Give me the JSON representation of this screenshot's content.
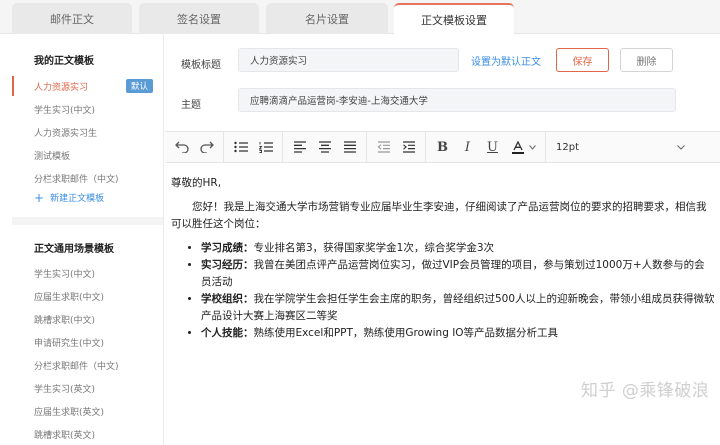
{
  "tabs": [
    "邮件正文",
    "签名设置",
    "名片设置",
    "正文模板设置"
  ],
  "sidebar": {
    "my_title": "我的正文模板",
    "my_items": [
      {
        "label": "人力资源实习",
        "badge": "默认"
      },
      {
        "label": "学生实习(中文)"
      },
      {
        "label": "人力资源实习生"
      },
      {
        "label": "测试模板"
      },
      {
        "label": "分栏求职邮件（中文)"
      }
    ],
    "new_label": "新建正文模板",
    "common_title": "正文通用场景模板",
    "common_items": [
      "学生实习(中文)",
      "应届生求职(中文)",
      "跳槽求职(中文)",
      "申请研究生(中文)",
      "分栏求职邮件（中文)",
      "学生实习(英文)",
      "应届生求职(英文)",
      "跳槽求职(英文)"
    ]
  },
  "form": {
    "title_label": "模板标题",
    "title_value": "人力资源实习",
    "subject_label": "主题",
    "subject_value": "应聘滴滴产品运营岗-李安迪-上海交通大学",
    "set_default": "设置为默认正文",
    "save": "保存",
    "delete": "删除"
  },
  "toolbar": {
    "icons": [
      "undo-icon",
      "redo-icon",
      "bullet-list-icon",
      "numbered-list-icon",
      "align-left-icon",
      "align-center-icon",
      "align-justify-icon",
      "outdent-icon",
      "indent-icon",
      "bold-icon",
      "italic-icon",
      "underline-icon",
      "font-color-icon"
    ],
    "font_size": "12pt"
  },
  "editor": {
    "greeting": "尊敬的HR,",
    "intro": "您好！我是上海交通大学市场营销专业应届毕业生李安迪，仔细阅读了产品运营岗位的要求的招聘要求，相信我可以胜任这个岗位：",
    "bullets": [
      {
        "k": "学习成绩：",
        "v": "专业排名第3，获得国家奖学金1次，综合奖学金3次"
      },
      {
        "k": "实习经历：",
        "v": "我曾在美团点评产品运营岗位实习，做过VIP会员管理的项目，参与策划过1000万+人数参与的会员活动"
      },
      {
        "k": "学校组织：",
        "v": "我在学院学生会担任学生会主席的职务，曾经组织过500人以上的迎新晚会，带领小组成员获得微软产品设计大赛上海赛区二等奖"
      },
      {
        "k": "个人技能：",
        "v": "熟练使用Excel和PPT，熟练使用Growing IO等产品数据分析工具"
      }
    ]
  },
  "watermark": "知乎 @乘锋破浪",
  "colors": {
    "accent": "#e0664a",
    "link": "#3a8ee6",
    "badge": "#5b9bd5"
  }
}
